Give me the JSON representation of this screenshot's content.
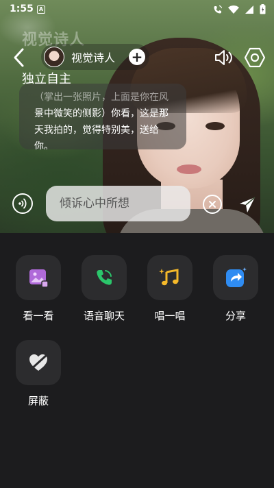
{
  "status_bar": {
    "time": "1:55",
    "app_icon_letter": "A"
  },
  "background": {
    "faded_title": "视觉诗人",
    "subtitle": "独立自主"
  },
  "header": {
    "character_name": "视觉诗人"
  },
  "message": {
    "line1_faded": "（掌出一张照片，上面是你在风",
    "line2": "景中微笑的侧影）你看，这是那",
    "line3": "天我拍的，觉得特别美，送给",
    "line4": "你。"
  },
  "input": {
    "placeholder": "倾诉心中所想"
  },
  "features": [
    {
      "label": "看一看",
      "icon": "image-icon",
      "color": "#b06ad9"
    },
    {
      "label": "语音聊天",
      "icon": "phone-icon",
      "color": "#2bc66b"
    },
    {
      "label": "唱一唱",
      "icon": "music-icon",
      "color": "#f5b92a"
    },
    {
      "label": "分享",
      "icon": "share-icon",
      "color": "#2f8cf2"
    },
    {
      "label": "屏蔽",
      "icon": "block-heart-icon",
      "color": "#ffffff"
    }
  ]
}
